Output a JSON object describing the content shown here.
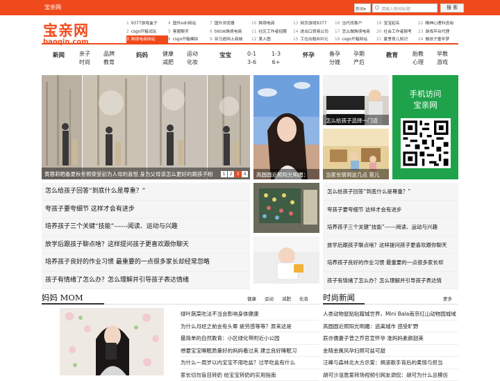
{
  "topbar": {
    "site_name": "宝亲网",
    "search_scope": "新闻▾",
    "search_placeholder": "请输入新闻标题",
    "search_button": "搜 索"
  },
  "logo": {
    "cn": "宝亲网",
    "en": "baoqin.com"
  },
  "hotlinks": [
    [
      {
        "n": "1",
        "t": "9377游戏盒子"
      },
      {
        "n": "4",
        "t": "国外sdn网站"
      },
      {
        "n": "7",
        "t": "国外浏览器"
      },
      {
        "n": "10",
        "t": "跨境电商"
      },
      {
        "n": "13",
        "t": "网页游戏9377"
      },
      {
        "n": "16",
        "t": "当代找客户"
      },
      {
        "n": "19",
        "t": "宝宝起名"
      },
      {
        "n": "22",
        "t": "精神心理科咨询"
      }
    ],
    [
      {
        "n": "2",
        "t": "csgo开箱试玩"
      },
      {
        "n": "5",
        "t": "客服聊天"
      },
      {
        "n": "8",
        "t": "tiktok跨境电商"
      },
      {
        "n": "11",
        "t": "社区工作者招聘"
      },
      {
        "n": "14",
        "t": "进出口贸易公司"
      },
      {
        "n": "17",
        "t": "怎么做跨境电商"
      },
      {
        "n": "20",
        "t": "社会工作者报考"
      },
      {
        "n": "23",
        "t": "游戏平台代理"
      }
    ],
    [
      {
        "n": "3",
        "t": "跨境电商网站"
      },
      {
        "n": "6",
        "t": "csgo开箱模拟"
      },
      {
        "n": "9",
        "t": "亚马逊网上商城"
      },
      {
        "n": "12",
        "t": "美人图"
      },
      {
        "n": "15",
        "t": "工位出租600元"
      },
      {
        "n": "18",
        "t": "csgo开箱网站"
      },
      {
        "n": "21",
        "t": "夏季育儿知识"
      },
      {
        "n": "24",
        "t": "做孩子童年梦"
      }
    ]
  ],
  "nav": {
    "news": "新闻",
    "parent_child_1": "亲子",
    "parent_child_2": "时尚",
    "brand_1": "品牌",
    "brand_2": "教育",
    "mom": "妈妈",
    "health_1": "健康",
    "health_2": "减肥",
    "sport_1": "运动",
    "sport_2": "化妆",
    "baby": "宝宝",
    "age1_1": "0-1",
    "age1_2": "3-6",
    "age2_1": "1-3",
    "age2_2": "6+",
    "pregnancy": "怀孕",
    "prep_1": "备孕",
    "prep_2": "分娩",
    "preg_1": "孕期",
    "preg_2": "产后",
    "education": "教育",
    "prenatal_1": "胎教",
    "prenatal_2": "心理",
    "early_1": "早教",
    "early_2": "游戏"
  },
  "slide": {
    "caption": "黄蓉莉晒备夏秋冬照穿受初为人母的喜悦 身为父母该怎么更好的跟孩子相",
    "pages": [
      "1",
      "2",
      "3",
      "4"
    ]
  },
  "photos": {
    "woman_caption": "高圆圆近照阳光明媚：",
    "piano_caption": "怎么给孩子选择一门适",
    "kids_caption": "当家长情到这几点 育儿"
  },
  "mobile": {
    "line1": "手机访问",
    "line2": "宝亲网"
  },
  "left_articles": [
    "怎么给孩子回答“到底什么是尊重？”",
    "夸孩子要夸细节 这样才会有进步",
    "培养孩子三个关键“技能”------阅读、运动与兴趣",
    "放学后跟孩子聊点啥？这样提问孩子更喜欢跟你聊天",
    "培养孩子良好的作业习惯 最重要的一点很多家长却经常忽略",
    "孩子有情绪了怎么办？怎么理解并引导孩子表达情绪"
  ],
  "right_articles": [
    "怎么给孩子回答“到底什么是尊重？”",
    "夸孩子要夸细节 这样才会有进步",
    "培养孩子三个关键“技能”------阅读、运动与兴趣",
    "放学后跟孩子聊点啥？这样提问孩子更喜欢跟你聊天",
    "培养孩子良好的作业习惯 最重要的一点很多家长却",
    "孩子有情绪了怎么办？怎么理解并引导孩子表达情"
  ],
  "mom_section": {
    "title": "妈妈 MOM",
    "tabs": [
      "健康",
      "运动",
      "减肥",
      "化妆"
    ],
    "items": [
      "绿叶蔬菜吃法不当会影响身体健康",
      "为什么月经之前会有头晕 疲劳感等等？原来这是",
      "最简单的自然教育：小区绿化带附近小公园",
      "想要宝宝睡眠质量好的妈妈看过来 建立良好睡眠习",
      "为什么一周岁以内宝宝不用吃盐？过早吃盐有什么",
      "家长切勿盲目转奶 给宝宝转奶的实用指南"
    ]
  },
  "news_section": {
    "title": "时尚新闻",
    "more": "更多",
    "items": [
      "人类动物鼠贴贴蹭城世界，Mini Bala南京红山动物园城域",
      "高圆圆近照阳光明媚：逃离城市 感受旷野",
      "辰亦儒妻子曾之乔官宣怀孕 准妈妈素颜甜美",
      "金晴金属风孕妇照可盐可甜",
      "汪峰与森林北大方示爱：揭滚歌手背后的柔情与担当",
      "胡可沙溢恩爱转场视频引网友调侃：胡可为什么总模仿"
    ]
  }
}
